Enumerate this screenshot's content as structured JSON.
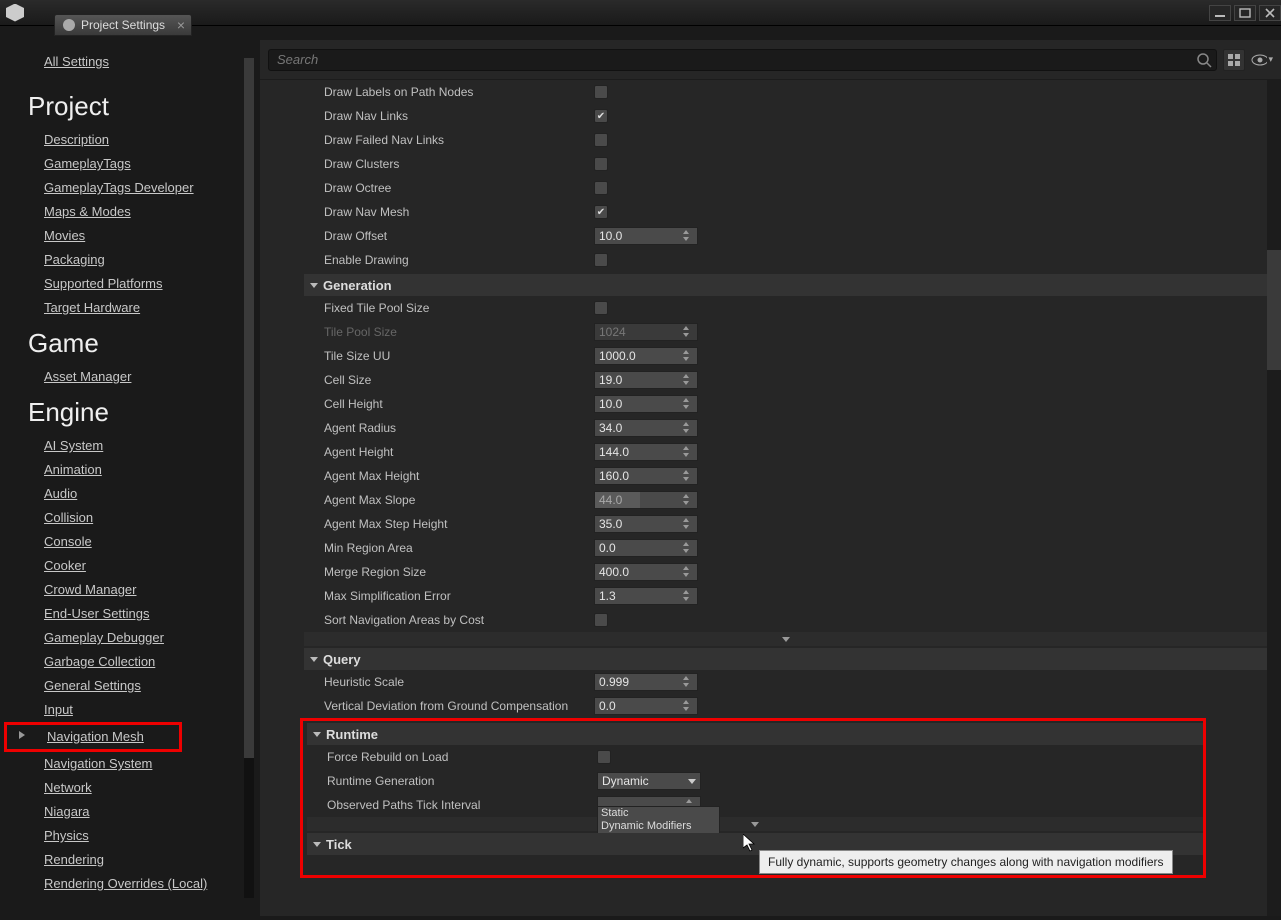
{
  "tab_title": "Project Settings",
  "search_placeholder": "Search",
  "sidebar": {
    "all_settings": "All Settings",
    "groups": [
      {
        "title": "Project",
        "items": [
          "Description",
          "GameplayTags",
          "GameplayTags Developer",
          "Maps & Modes",
          "Movies",
          "Packaging",
          "Supported Platforms",
          "Target Hardware"
        ]
      },
      {
        "title": "Game",
        "items": [
          "Asset Manager"
        ]
      },
      {
        "title": "Engine",
        "items": [
          "AI System",
          "Animation",
          "Audio",
          "Collision",
          "Console",
          "Cooker",
          "Crowd Manager",
          "End-User Settings",
          "Gameplay Debugger",
          "Garbage Collection",
          "General Settings",
          "Input",
          "Navigation Mesh",
          "Navigation System",
          "Network",
          "Niagara",
          "Physics",
          "Rendering",
          "Rendering Overrides (Local)"
        ]
      }
    ],
    "selected": "Navigation Mesh"
  },
  "sections": {
    "misc_rows": [
      {
        "label": "Draw Labels on Path Nodes",
        "type": "check",
        "value": false
      },
      {
        "label": "Draw Nav Links",
        "type": "check",
        "value": true
      },
      {
        "label": "Draw Failed Nav Links",
        "type": "check",
        "value": false
      },
      {
        "label": "Draw Clusters",
        "type": "check",
        "value": false
      },
      {
        "label": "Draw Octree",
        "type": "check",
        "value": false
      },
      {
        "label": "Draw Nav Mesh",
        "type": "check",
        "value": true
      },
      {
        "label": "Draw Offset",
        "type": "num",
        "value": "10.0"
      },
      {
        "label": "Enable Drawing",
        "type": "check",
        "value": false
      }
    ],
    "generation": {
      "title": "Generation",
      "rows": [
        {
          "label": "Fixed Tile Pool Size",
          "type": "check",
          "value": false
        },
        {
          "label": "Tile Pool Size",
          "type": "num",
          "value": "1024",
          "disabled": true
        },
        {
          "label": "Tile Size UU",
          "type": "num",
          "value": "1000.0"
        },
        {
          "label": "Cell Size",
          "type": "num",
          "value": "19.0"
        },
        {
          "label": "Cell Height",
          "type": "num",
          "value": "10.0"
        },
        {
          "label": "Agent Radius",
          "type": "num",
          "value": "34.0"
        },
        {
          "label": "Agent Height",
          "type": "num",
          "value": "144.0"
        },
        {
          "label": "Agent Max Height",
          "type": "num",
          "value": "160.0"
        },
        {
          "label": "Agent Max Slope",
          "type": "num",
          "value": "44.0",
          "partial": true
        },
        {
          "label": "Agent Max Step Height",
          "type": "num",
          "value": "35.0"
        },
        {
          "label": "Min Region Area",
          "type": "num",
          "value": "0.0"
        },
        {
          "label": "Merge Region Size",
          "type": "num",
          "value": "400.0"
        },
        {
          "label": "Max Simplification Error",
          "type": "num",
          "value": "1.3"
        },
        {
          "label": "Sort Navigation Areas by Cost",
          "type": "check",
          "value": false
        }
      ]
    },
    "query": {
      "title": "Query",
      "rows": [
        {
          "label": "Heuristic Scale",
          "type": "num",
          "value": "0.999"
        },
        {
          "label": "Vertical Deviation from Ground Compensation",
          "type": "num",
          "value": "0.0"
        }
      ]
    },
    "runtime": {
      "title": "Runtime",
      "rows": [
        {
          "label": "Force Rebuild on Load",
          "type": "check",
          "value": false
        },
        {
          "label": "Runtime Generation",
          "type": "dropdown",
          "value": "Dynamic"
        },
        {
          "label": "Observed Paths Tick Interval",
          "type": "num",
          "value": ""
        }
      ],
      "dropdown_options": [
        "Static",
        "Dynamic Modifiers Only",
        "Dynamic"
      ],
      "dropdown_highlight": "Dynamic"
    },
    "tick": {
      "title": "Tick"
    }
  },
  "tooltip": "Fully dynamic, supports geometry changes along with navigation modifiers"
}
